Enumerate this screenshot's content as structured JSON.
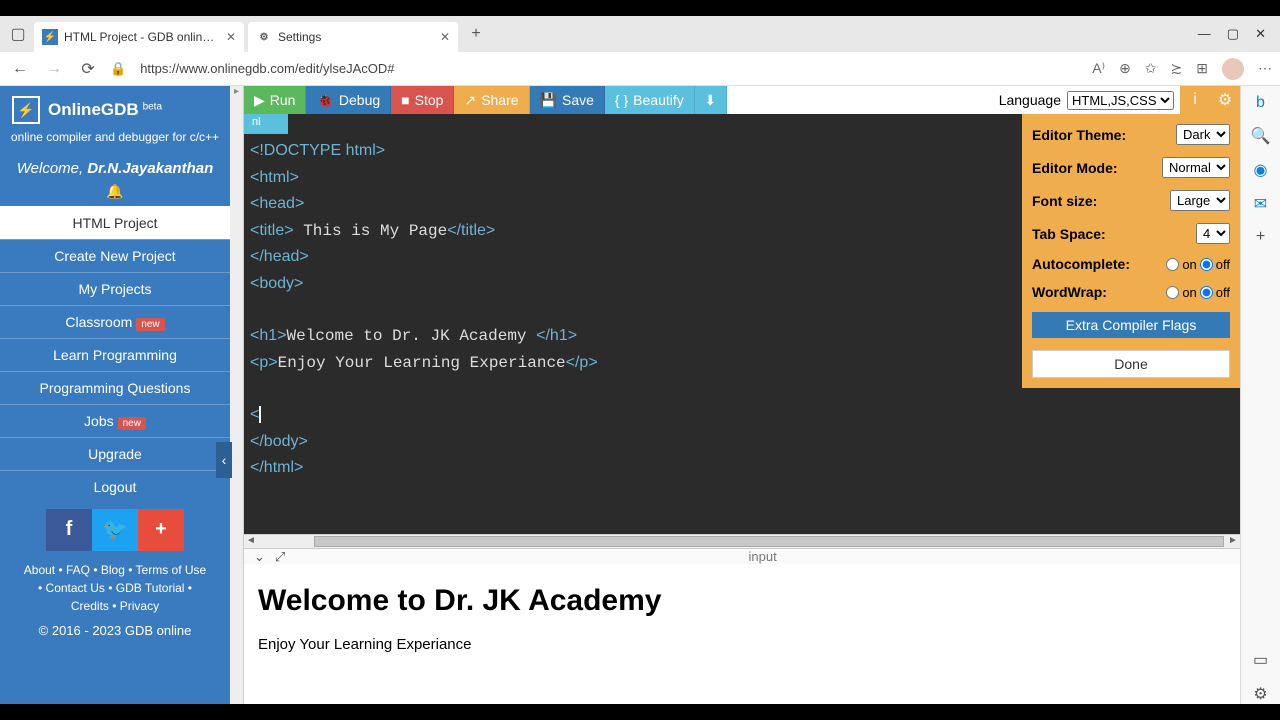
{
  "browser": {
    "tabs": [
      {
        "title": "HTML Project - GDB online Debu",
        "favicon": "bolt"
      },
      {
        "title": "Settings",
        "favicon": "gear"
      }
    ],
    "url": "https://www.onlinegdb.com/edit/ylseJAcOD#"
  },
  "sidebar": {
    "brand": "OnlineGDB",
    "beta": "beta",
    "tagline": "online compiler and debugger for c/c++",
    "welcome_prefix": "Welcome, ",
    "welcome_name": "Dr.N.Jayakanthan",
    "items": [
      {
        "label": "HTML Project",
        "active": true
      },
      {
        "label": "Create New Project"
      },
      {
        "label": "My Projects"
      },
      {
        "label": "Classroom",
        "badge": "new"
      },
      {
        "label": "Learn Programming"
      },
      {
        "label": "Programming Questions"
      },
      {
        "label": "Jobs",
        "badge": "new"
      },
      {
        "label": "Upgrade"
      },
      {
        "label": "Logout"
      }
    ],
    "footer_links_1": "About • FAQ • Blog • Terms of Use",
    "footer_links_2": "• Contact Us • GDB Tutorial •",
    "footer_links_3": "Credits • Privacy",
    "copyright": "© 2016 - 2023 GDB online"
  },
  "toolbar": {
    "run": "Run",
    "debug": "Debug",
    "stop": "Stop",
    "share": "Share",
    "save": "Save",
    "beautify": "Beautify",
    "language_label": "Language",
    "language_value": "HTML,JS,CSS"
  },
  "file_tab": "nl",
  "code_lines": [
    "<!DOCTYPE html>",
    "<html>",
    "<head>",
    "<title> This is My Page</title>",
    "</head>",
    "<body>",
    "",
    "<h1>Welcome to Dr. JK Academy </h1>",
    "<p>Enjoy Your Learning Experiance</p>",
    "",
    "<",
    "</body>",
    "</html>"
  ],
  "io_label": "input",
  "preview": {
    "h1": "Welcome to Dr. JK Academy",
    "p": "Enjoy Your Learning Experiance"
  },
  "settings": {
    "theme_label": "Editor Theme:",
    "theme_value": "Dark",
    "mode_label": "Editor Mode:",
    "mode_value": "Normal",
    "font_label": "Font size:",
    "font_value": "Large",
    "tab_label": "Tab Space:",
    "tab_value": "4",
    "ac_label": "Autocomplete:",
    "on": "on",
    "off": "off",
    "ww_label": "WordWrap:",
    "flags": "Extra Compiler Flags",
    "done": "Done"
  }
}
